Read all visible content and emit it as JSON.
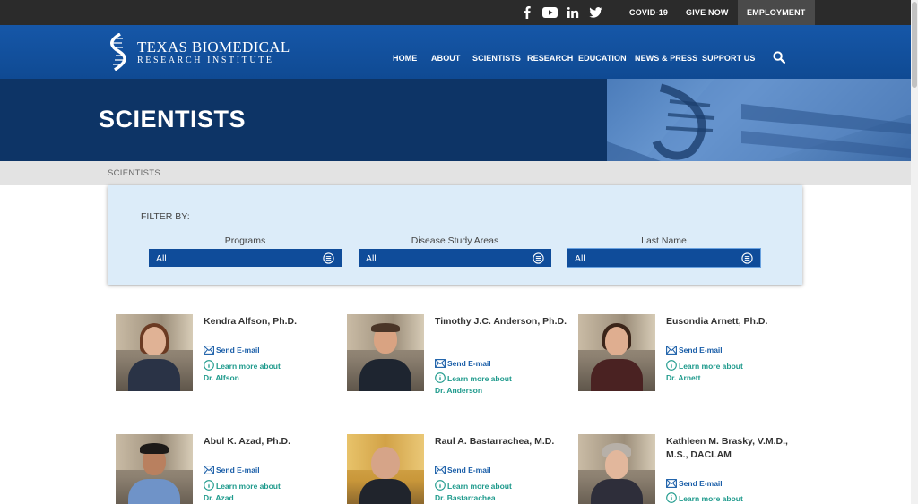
{
  "topbar": {
    "social_icons": [
      "facebook-icon",
      "youtube-icon",
      "linkedin-icon",
      "twitter-icon"
    ],
    "links": [
      "COVID-19",
      "GIVE NOW",
      "EMPLOYMENT"
    ]
  },
  "brand": {
    "line1": "Texas Biomedical",
    "line2": "Research Institute"
  },
  "nav": [
    "HOME",
    "ABOUT",
    "SCIENTISTS",
    "RESEARCH",
    "EDUCATION",
    "NEWS & PRESS",
    "SUPPORT US"
  ],
  "hero": {
    "title": "SCIENTISTS"
  },
  "breadcrumb": "SCIENTISTS",
  "filter": {
    "title": "FILTER BY:",
    "fields": [
      {
        "label": "Programs",
        "value": "All"
      },
      {
        "label": "Disease Study Areas",
        "value": "All"
      },
      {
        "label": "Last Name",
        "value": "All"
      }
    ]
  },
  "scientists": [
    {
      "name": "Kendra Alfson, Ph.D.",
      "email_label": "Send E-mail",
      "learn_label": "Learn more about",
      "learn_name": "Dr. Alfson"
    },
    {
      "name": "Timothy J.C. Anderson, Ph.D.",
      "email_label": "Send E-mail",
      "learn_label": "Learn more about",
      "learn_name": "Dr. Anderson"
    },
    {
      "name": "Eusondia Arnett, Ph.D.",
      "email_label": "Send E-mail",
      "learn_label": "Learn more about",
      "learn_name": "Dr. Arnett"
    },
    {
      "name": "Abul K. Azad, Ph.D.",
      "email_label": "Send E-mail",
      "learn_label": "Learn more about",
      "learn_name": "Dr. Azad"
    },
    {
      "name": "Raul A. Bastarrachea, M.D.",
      "email_label": "Send E-mail",
      "learn_label": "Learn more about",
      "learn_name": "Dr. Bastarrachea"
    },
    {
      "name": "Kathleen M. Brasky, V.M.D., M.S., DACLAM",
      "email_label": "Send E-mail",
      "learn_label": "Learn more about",
      "learn_name": ""
    }
  ],
  "colors": {
    "topbar": "#2b2b2b",
    "header": "#1657a8",
    "hero": "#0d3466",
    "filter_panel": "#dcecf9",
    "select": "#0f4c9a",
    "accent_link": "#1e9a8c"
  }
}
